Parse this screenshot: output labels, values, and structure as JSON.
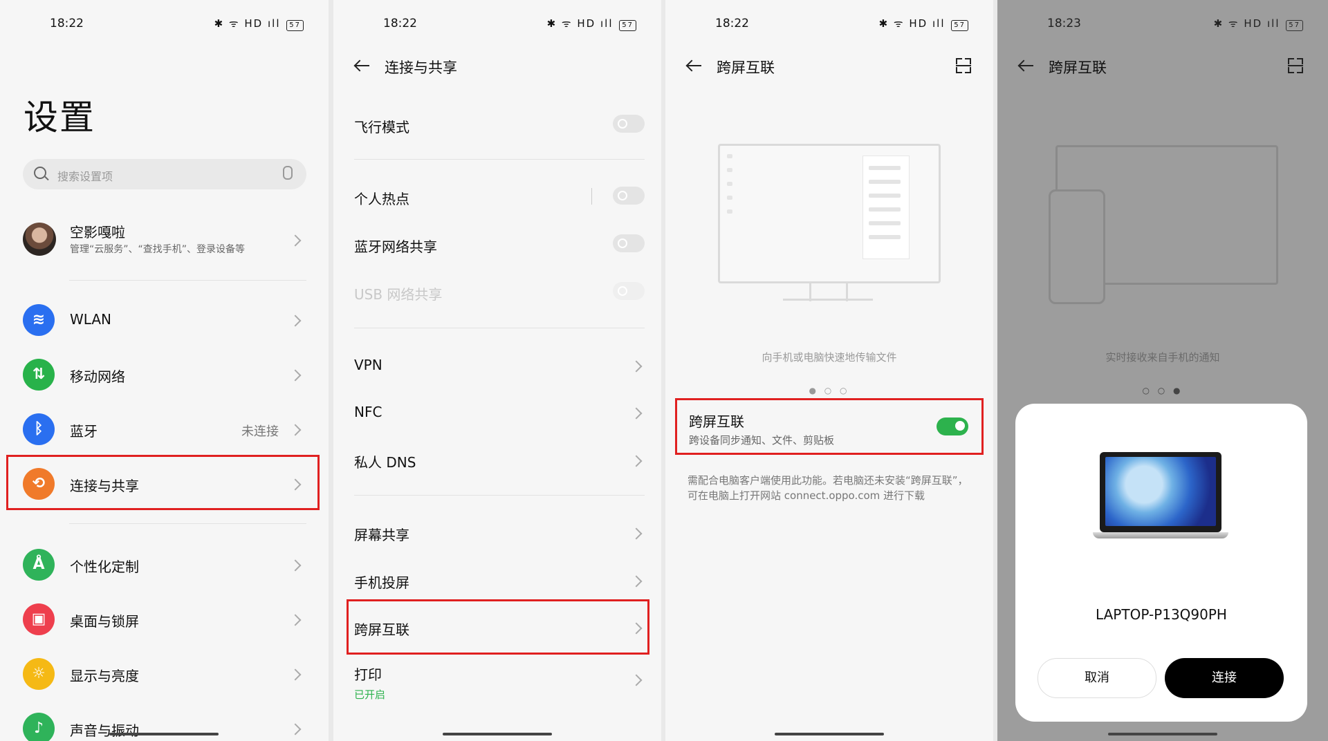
{
  "status": {
    "time": "18:22",
    "time4": "18:23",
    "battery": "57"
  },
  "p1": {
    "title": "设置",
    "search_placeholder": "搜索设置项",
    "account": {
      "name": "空影嘎啦",
      "sub": "管理“云服务”、“查找手机”、登录设备等"
    },
    "items": [
      {
        "label": "WLAN",
        "value": ""
      },
      {
        "label": "移动网络",
        "value": ""
      },
      {
        "label": "蓝牙",
        "value": "未连接"
      },
      {
        "label": "连接与共享",
        "value": ""
      },
      {
        "label": "个性化定制",
        "value": ""
      },
      {
        "label": "桌面与锁屏",
        "value": ""
      },
      {
        "label": "显示与亮度",
        "value": ""
      },
      {
        "label": "声音与振动",
        "value": ""
      }
    ],
    "icon_colors": [
      "#2a6ff0",
      "#28b24a",
      "#2a6ff0",
      "#f07a2a",
      "#2fb35a",
      "#ee3f4d",
      "#f5b915",
      "#2fb35a"
    ]
  },
  "p2": {
    "title": "连接与共享",
    "items": [
      {
        "label": "飞行模式"
      },
      {
        "label": "个人热点"
      },
      {
        "label": "蓝牙网络共享"
      },
      {
        "label": "USB 网络共享"
      },
      {
        "label": "VPN"
      },
      {
        "label": "NFC"
      },
      {
        "label": "私人 DNS"
      },
      {
        "label": "屏幕共享"
      },
      {
        "label": "手机投屏"
      },
      {
        "label": "跨屏互联"
      },
      {
        "label": "打印",
        "sub": "已开启"
      }
    ]
  },
  "p3": {
    "title": "跨屏互联",
    "caption": "向手机或电脑快速地传输文件",
    "card_title": "跨屏互联",
    "card_sub": "跨设备同步通知、文件、剪贴板",
    "note": "需配合电脑客户端使用此功能。若电脑还未安装“跨屏互联”，可在电脑上打开网站 connect.oppo.com 进行下载",
    "dots": "● ○ ○"
  },
  "p4": {
    "title": "跨屏互联",
    "caption": "实时接收来自手机的通知",
    "dots": "○ ○ ●",
    "device": "LAPTOP-P13Q90PH",
    "cancel": "取消",
    "connect": "连接"
  }
}
